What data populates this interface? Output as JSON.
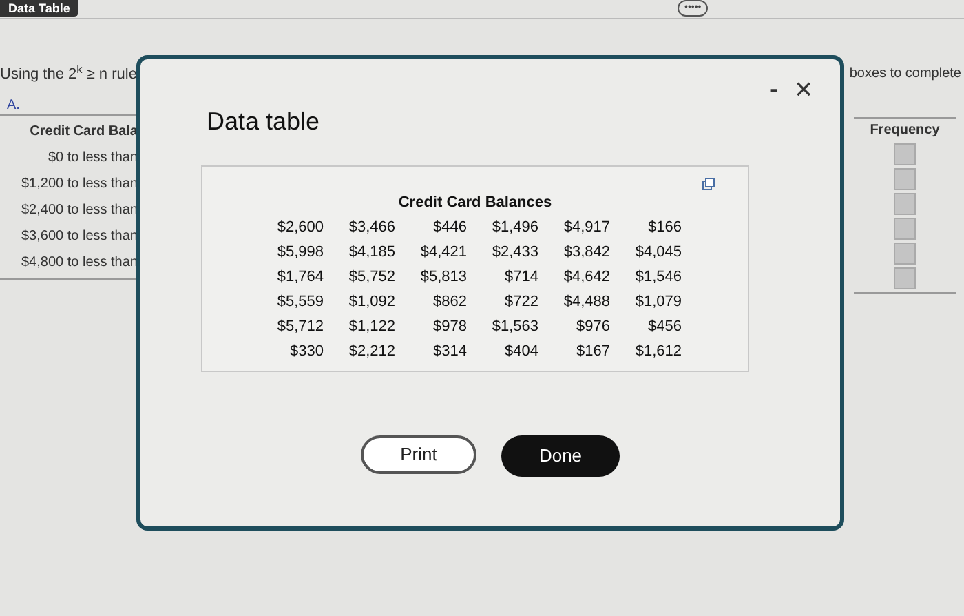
{
  "top_tab": {
    "label": "Data Table"
  },
  "handle": {
    "label": "•••••"
  },
  "instruction": {
    "start": "Using the 2$^{k}$ ≥ n rule",
    "end": "boxes to complete"
  },
  "background_table": {
    "choice_label": "A.",
    "header": "Credit Card Bala",
    "rows": [
      "$0 to less than",
      "$1,200 to less than",
      "$2,400 to less than",
      "$3,600 to less than",
      "$4,800 to less than"
    ]
  },
  "frequency": {
    "header": "Frequency",
    "boxes": [
      {
        "kind": "input"
      },
      {
        "kind": "input"
      },
      {
        "kind": "input"
      },
      {
        "kind": "input"
      },
      {
        "kind": "input"
      },
      {
        "kind": "input"
      }
    ]
  },
  "dialog": {
    "title": "Data table",
    "minimize": "-",
    "close": "×",
    "table": {
      "title": "Credit Card Balances",
      "rows": [
        [
          "$2,600",
          "$3,466",
          "$446",
          "$1,496",
          "$4,917",
          "$166"
        ],
        [
          "$5,998",
          "$4,185",
          "$4,421",
          "$2,433",
          "$3,842",
          "$4,045"
        ],
        [
          "$1,764",
          "$5,752",
          "$5,813",
          "$714",
          "$4,642",
          "$1,546"
        ],
        [
          "$5,559",
          "$1,092",
          "$862",
          "$722",
          "$4,488",
          "$1,079"
        ],
        [
          "$5,712",
          "$1,122",
          "$978",
          "$1,563",
          "$976",
          "$456"
        ],
        [
          "$330",
          "$2,212",
          "$314",
          "$404",
          "$167",
          "$1,612"
        ]
      ]
    },
    "buttons": [
      {
        "label": "Print",
        "kind": "outline"
      },
      {
        "label": "Done",
        "kind": "primary"
      }
    ]
  }
}
